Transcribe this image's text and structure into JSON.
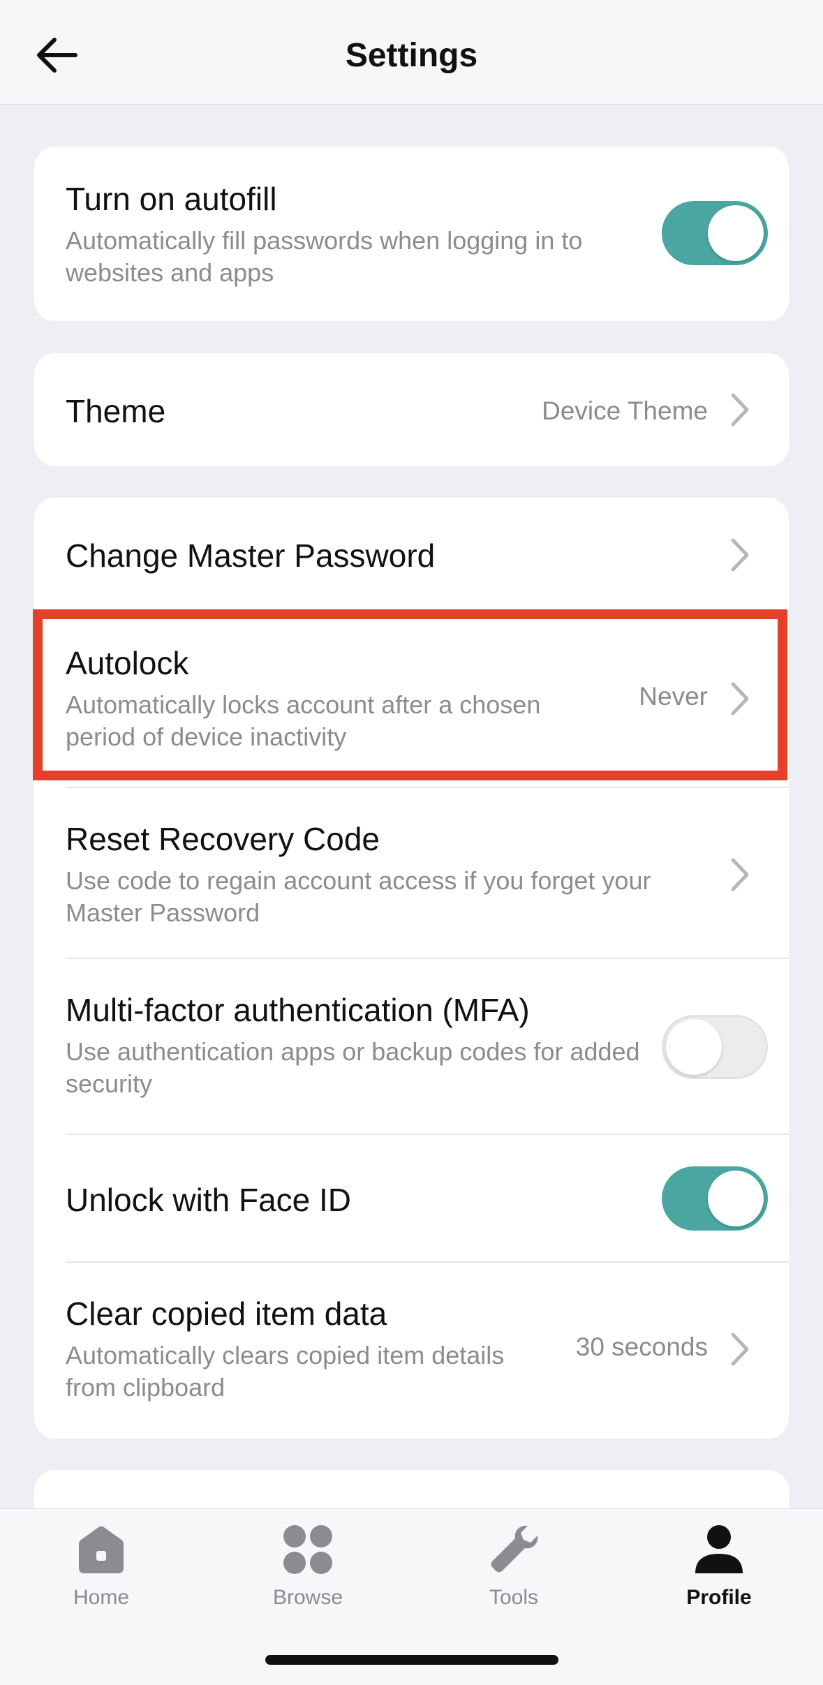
{
  "header": {
    "title": "Settings"
  },
  "autofill": {
    "title": "Turn on autofill",
    "subtitle": "Automatically fill passwords when logging in to websites and apps",
    "enabled": true
  },
  "theme": {
    "title": "Theme",
    "value": "Device Theme"
  },
  "security": {
    "change_master_password": {
      "title": "Change Master Password"
    },
    "autolock": {
      "title": "Autolock",
      "subtitle": "Automatically locks account after a chosen period of device inactivity",
      "value": "Never"
    },
    "reset_recovery": {
      "title": "Reset Recovery Code",
      "subtitle": "Use code to regain account access if you forget your Master Password"
    },
    "mfa": {
      "title": "Multi-factor authentication (MFA)",
      "subtitle": "Use authentication apps or backup codes for added security",
      "enabled": false
    },
    "face_id": {
      "title": "Unlock with Face ID",
      "enabled": true
    },
    "clear_copied": {
      "title": "Clear copied item data",
      "subtitle": "Automatically clears copied item details from clipboard",
      "value": "30 seconds"
    }
  },
  "tabbar": {
    "items": [
      {
        "label": "Home",
        "icon": "home-icon",
        "active": false
      },
      {
        "label": "Browse",
        "icon": "grid-icon",
        "active": false
      },
      {
        "label": "Tools",
        "icon": "wrench-icon",
        "active": false
      },
      {
        "label": "Profile",
        "icon": "person-icon",
        "active": true
      }
    ]
  },
  "colors": {
    "accent": "#4aa6a1",
    "highlight": "#e5402a",
    "background": "#efeef4"
  }
}
